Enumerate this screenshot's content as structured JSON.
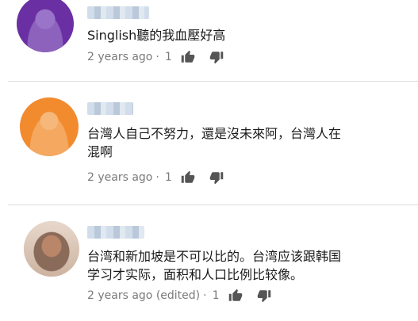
{
  "comments": [
    {
      "text": "Singlish聽的我血壓好高",
      "time": "2 years ago",
      "likes": "1",
      "separator": "·"
    },
    {
      "text_line1": "台灣人自己不努力，還是沒未來阿，台灣人在",
      "text_line2": "混啊",
      "time": "2 years ago",
      "likes": "1",
      "separator": "·"
    },
    {
      "text_line1": "台湾和新加坡是不可以比的。台湾应该跟韩国",
      "text_line2": "学习才实际，面积和人口比例比较像。",
      "time": "2 years ago (edited)",
      "likes": "1",
      "separator": "·"
    }
  ],
  "colors": {
    "avatar1": "#6a2fa3",
    "avatar2": "#f28a2e",
    "avatar3": "#c9a38a",
    "meta": "#7a7a7a",
    "icon": "#555555"
  },
  "icons": {
    "like": "thumbs-up-icon",
    "dislike": "thumbs-down-icon"
  }
}
